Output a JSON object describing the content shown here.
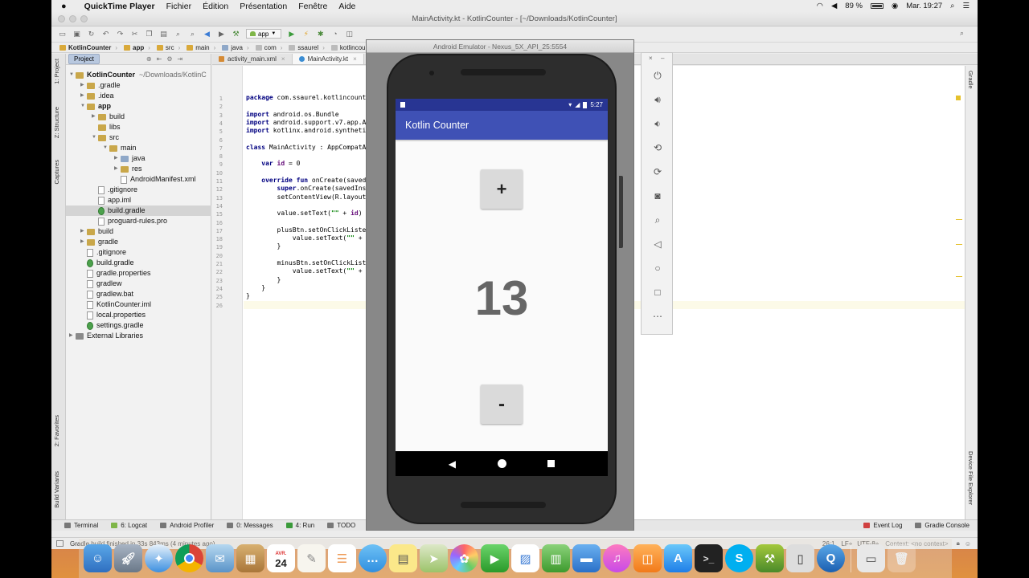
{
  "menubar": {
    "apple": "",
    "app_name": "QuickTime Player",
    "items": [
      "Fichier",
      "Édition",
      "Présentation",
      "Fenêtre",
      "Aide"
    ],
    "battery": "89 %",
    "clock": "Mar. 19:27"
  },
  "ide": {
    "window_title": "MainActivity.kt - KotlinCounter - [~/Downloads/KotlinCounter]",
    "run_config": "app",
    "breadcrumbs": [
      "KotlinCounter",
      "app",
      "src",
      "main",
      "java",
      "com",
      "ssaurel",
      "kotlincounter"
    ],
    "project_tab": "Project",
    "editor_tabs": [
      {
        "label": "activity_main.xml",
        "active": false
      },
      {
        "label": "MainActivity.kt",
        "active": true
      }
    ],
    "left_tabs": [
      "1: Project",
      "Z: Structure",
      "Captures",
      "2: Favorites",
      "Build Variants"
    ],
    "right_tabs": [
      "Gradle",
      "Device File Explorer"
    ],
    "tree": [
      {
        "label": "KotlinCounter",
        "sub": "~/Downloads/KotlinC",
        "kind": "folder",
        "bold": true
      },
      {
        "label": ".gradle",
        "kind": "folder"
      },
      {
        "label": ".idea",
        "kind": "folder"
      },
      {
        "label": "app",
        "kind": "folder",
        "bold": true
      },
      {
        "label": "build",
        "kind": "folder"
      },
      {
        "label": "libs",
        "kind": "folder"
      },
      {
        "label": "src",
        "kind": "folder"
      },
      {
        "label": "main",
        "kind": "folder"
      },
      {
        "label": "java",
        "kind": "folder-blue"
      },
      {
        "label": "res",
        "kind": "folder"
      },
      {
        "label": "AndroidManifest.xml",
        "kind": "file"
      },
      {
        "label": ".gitignore",
        "kind": "file"
      },
      {
        "label": "app.iml",
        "kind": "file"
      },
      {
        "label": "build.gradle",
        "kind": "gradle",
        "selected": true
      },
      {
        "label": "proguard-rules.pro",
        "kind": "file"
      },
      {
        "label": "build",
        "kind": "folder"
      },
      {
        "label": "gradle",
        "kind": "folder"
      },
      {
        "label": ".gitignore",
        "kind": "file"
      },
      {
        "label": "build.gradle",
        "kind": "gradle"
      },
      {
        "label": "gradle.properties",
        "kind": "file"
      },
      {
        "label": "gradlew",
        "kind": "file"
      },
      {
        "label": "gradlew.bat",
        "kind": "file"
      },
      {
        "label": "KotlinCounter.iml",
        "kind": "file"
      },
      {
        "label": "local.properties",
        "kind": "file"
      },
      {
        "label": "settings.gradle",
        "kind": "gradle"
      },
      {
        "label": "External Libraries",
        "kind": "lib"
      }
    ],
    "line_numbers": [
      "1",
      "2",
      "3",
      "4",
      "5",
      "6",
      "7",
      "8",
      "9",
      "10",
      "11",
      "12",
      "13",
      "14",
      "15",
      "16",
      "17",
      "18",
      "19",
      "20",
      "21",
      "22",
      "23",
      "24",
      "25",
      "26"
    ],
    "code": [
      "package com.ssaurel.kotlincount",
      "",
      "import android.os.Bundle",
      "import android.support.v7.app.A",
      "import kotlinx.android.syntheti",
      "",
      "class MainActivity : AppCompatA",
      "",
      "    var id = 0",
      "",
      "    override fun onCreate(saved",
      "        super.onCreate(savedIns",
      "        setContentView(R.layout",
      "",
      "        value.setText(\"\" + id)",
      "",
      "        plusBtn.setOnClickListe",
      "            value.setText(\"\" +",
      "        }",
      "",
      "        minusBtn.setOnClickList",
      "            value.setText(\"\" +",
      "        }",
      "    }",
      "}",
      ""
    ],
    "bottom_tabs": [
      "Terminal",
      "6: Logcat",
      "Android Profiler",
      "0: Messages",
      "4: Run",
      "TODO"
    ],
    "bottom_right_tabs": [
      "Event Log",
      "Gradle Console"
    ],
    "status_message": "Gradle build finished in 33s 843ms (4 minutes ago)",
    "cursor": "26:1",
    "line_sep": "LF÷",
    "encoding": "UTF-8÷",
    "context": "Context: <no context>"
  },
  "emulator": {
    "title": "Android Emulator - Nexus_5X_API_25:5554",
    "time": "5:27",
    "app_title": "Kotlin Counter",
    "plus_label": "+",
    "minus_label": "-",
    "counter_value": "13"
  },
  "dock": {
    "calendar_day": "24",
    "calendar_month": "AVR."
  }
}
